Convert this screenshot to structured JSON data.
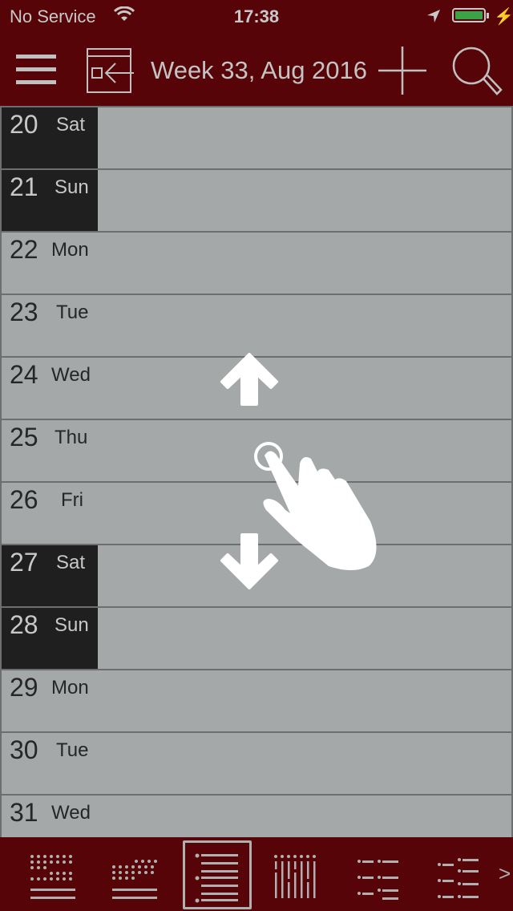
{
  "status_bar": {
    "carrier": "No Service",
    "time": "17:38",
    "battery_percent": 100,
    "battery_color": "#3da14a",
    "icons": [
      "wifi-icon",
      "location-arrow-icon",
      "battery-icon",
      "charging-bolt-icon"
    ]
  },
  "nav_bar": {
    "title": "Week 33, Aug 2016",
    "background": "#560408",
    "buttons": [
      "menu-icon",
      "go-to-today-icon",
      "add-icon",
      "search-icon"
    ]
  },
  "days": [
    {
      "num": "20",
      "name": "Sat",
      "weekend": true
    },
    {
      "num": "21",
      "name": "Sun",
      "weekend": true
    },
    {
      "num": "22",
      "name": "Mon",
      "weekend": false
    },
    {
      "num": "23",
      "name": "Tue",
      "weekend": false
    },
    {
      "num": "24",
      "name": "Wed",
      "weekend": false
    },
    {
      "num": "25",
      "name": "Thu",
      "weekend": false
    },
    {
      "num": "26",
      "name": "Fri",
      "weekend": false
    },
    {
      "num": "27",
      "name": "Sat",
      "weekend": true
    },
    {
      "num": "28",
      "name": "Sun",
      "weekend": true
    },
    {
      "num": "29",
      "name": "Mon",
      "weekend": false
    },
    {
      "num": "30",
      "name": "Tue",
      "weekend": false
    },
    {
      "num": "31",
      "name": "Wed",
      "weekend": false
    }
  ],
  "gesture_hint": {
    "description": "swipe up or down to scroll",
    "icons": [
      "arrow-up-icon",
      "touch-hand-icon",
      "arrow-down-icon"
    ]
  },
  "tab_bar": {
    "selected_index": 2,
    "tabs": [
      "month-view",
      "multi-week-view",
      "week-list-view",
      "week-columns-view",
      "day-list-view",
      "agenda-view"
    ],
    "more_label": ">"
  }
}
